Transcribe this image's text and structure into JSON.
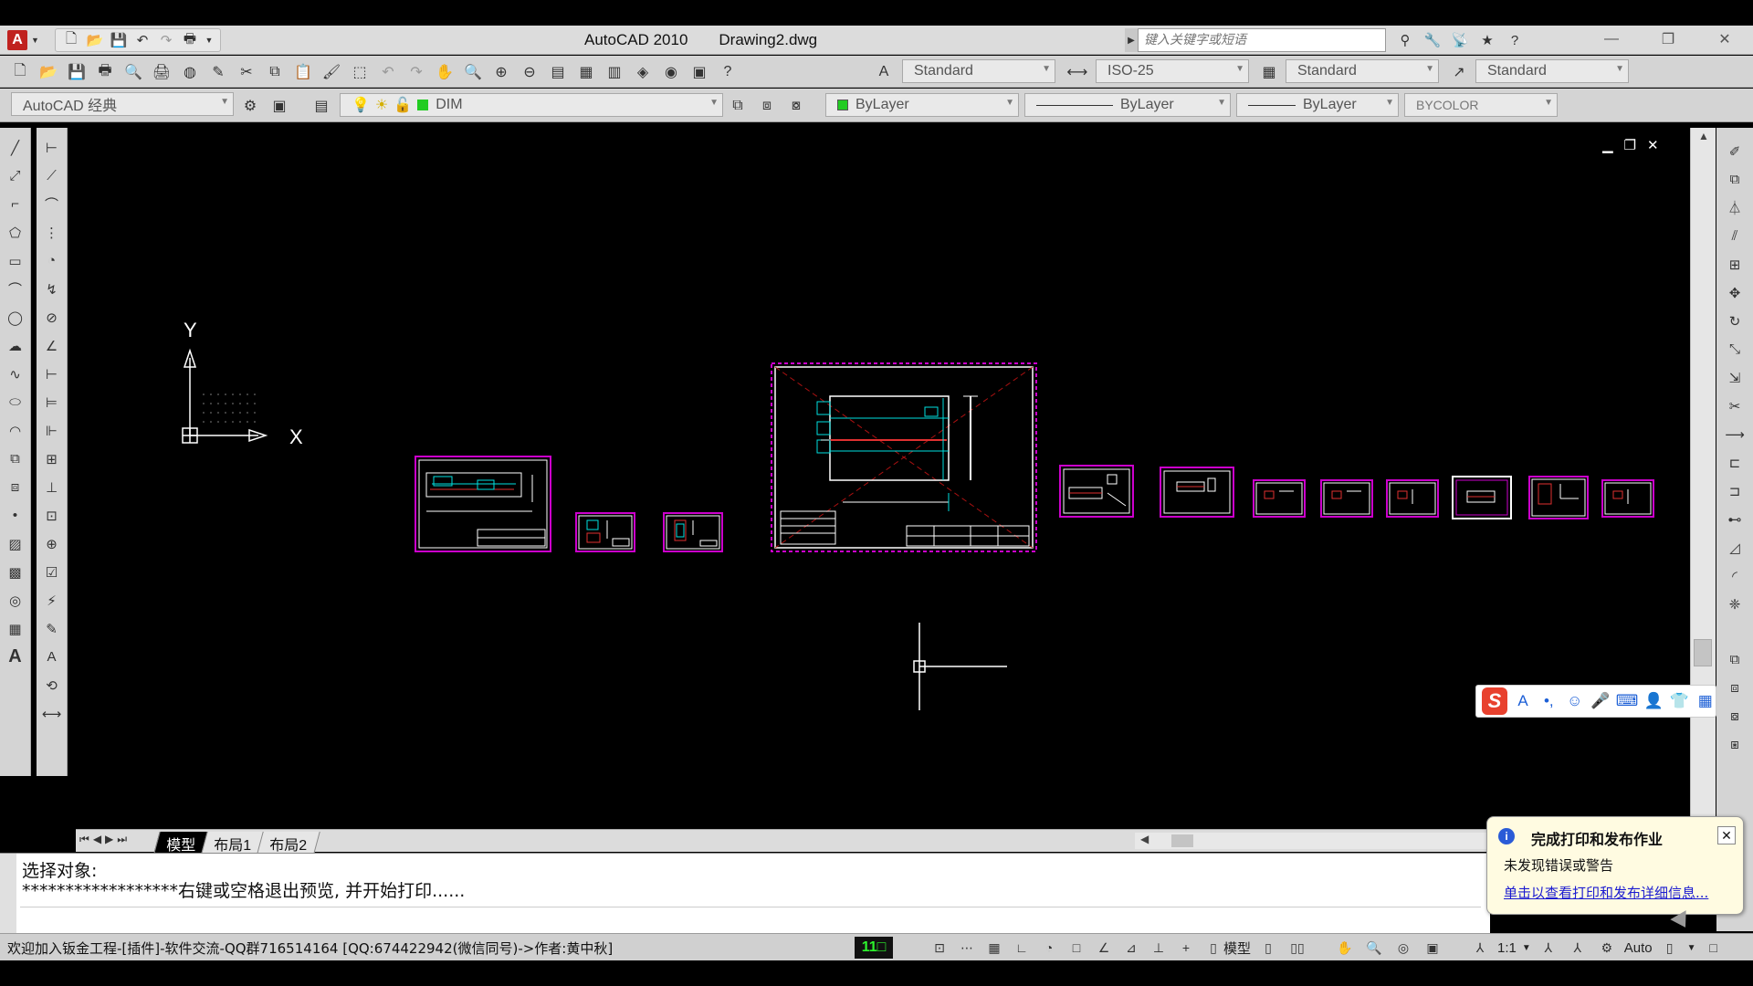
{
  "titlebar": {
    "app_name": "AutoCAD 2010",
    "file_name": "Drawing2.dwg",
    "search_placeholder": "键入关键字或短语"
  },
  "toolbar1": {
    "text_style": "Standard",
    "dim_style": "ISO-25",
    "table_style": "Standard",
    "multileader_style": "Standard"
  },
  "toolbar2": {
    "workspace": "AutoCAD 经典",
    "layer": "DIM",
    "color": "ByLayer",
    "linetype": "ByLayer",
    "lineweight": "ByLayer",
    "plotstyle": "BYCOLOR",
    "layer_color": "#22cc22"
  },
  "canvas": {
    "background": "#000000",
    "ucs_x_label": "X",
    "ucs_y_label": "Y",
    "frame_color": "#cc00cc",
    "line_color": "#00e0e0",
    "dim_color": "#ffffff"
  },
  "tabs": {
    "model": "模型",
    "layout1": "布局1",
    "layout2": "布局2"
  },
  "command": {
    "line1": "选择对象:",
    "line2": "******************右键或空格退出预览, 并开始打印......"
  },
  "notification": {
    "title": "完成打印和发布作业",
    "message": "未发现错误或警告",
    "link": "单击以查看打印和发布详细信息..."
  },
  "status": {
    "coords_text": "欢迎加入钣金工程-[插件]-软件交流-QQ群716514164 [QQ:674422942(微信同号)->作者:黄中秋]",
    "badge": "11□",
    "model_label": "模型",
    "scale": "1:1",
    "workspace_short": "Auto"
  }
}
